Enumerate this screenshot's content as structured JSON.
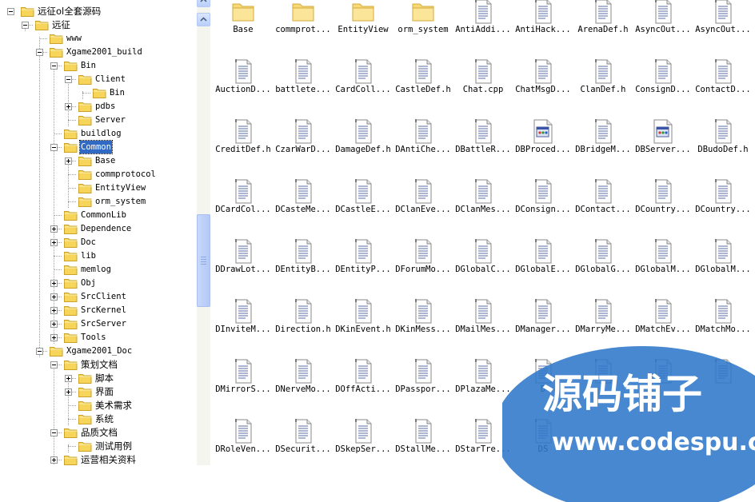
{
  "tree": {
    "items": [
      {
        "label": "远征ol全套源码",
        "depth": 0,
        "expander": "minus",
        "selected": false
      },
      {
        "label": "远征",
        "depth": 1,
        "expander": "minus",
        "selected": false
      },
      {
        "label": "www",
        "depth": 2,
        "expander": "none",
        "selected": false
      },
      {
        "label": "Xgame2001_build",
        "depth": 2,
        "expander": "minus",
        "selected": false
      },
      {
        "label": "Bin",
        "depth": 3,
        "expander": "minus",
        "selected": false
      },
      {
        "label": "Client",
        "depth": 4,
        "expander": "minus",
        "selected": false
      },
      {
        "label": "Bin",
        "depth": 5,
        "expander": "none",
        "selected": false
      },
      {
        "label": "pdbs",
        "depth": 4,
        "expander": "plus",
        "selected": false
      },
      {
        "label": "Server",
        "depth": 4,
        "expander": "none",
        "selected": false
      },
      {
        "label": "buildlog",
        "depth": 3,
        "expander": "none",
        "selected": false
      },
      {
        "label": "Common",
        "depth": 3,
        "expander": "minus",
        "selected": true
      },
      {
        "label": "Base",
        "depth": 4,
        "expander": "plus",
        "selected": false
      },
      {
        "label": "commprotocol",
        "depth": 4,
        "expander": "none",
        "selected": false
      },
      {
        "label": "EntityView",
        "depth": 4,
        "expander": "none",
        "selected": false
      },
      {
        "label": "orm_system",
        "depth": 4,
        "expander": "none",
        "selected": false
      },
      {
        "label": "CommonLib",
        "depth": 3,
        "expander": "none",
        "selected": false
      },
      {
        "label": "Dependence",
        "depth": 3,
        "expander": "plus",
        "selected": false
      },
      {
        "label": "Doc",
        "depth": 3,
        "expander": "plus",
        "selected": false
      },
      {
        "label": "lib",
        "depth": 3,
        "expander": "none",
        "selected": false
      },
      {
        "label": "memlog",
        "depth": 3,
        "expander": "none",
        "selected": false
      },
      {
        "label": "Obj",
        "depth": 3,
        "expander": "plus",
        "selected": false
      },
      {
        "label": "SrcClient",
        "depth": 3,
        "expander": "plus",
        "selected": false
      },
      {
        "label": "SrcKernel",
        "depth": 3,
        "expander": "plus",
        "selected": false
      },
      {
        "label": "SrcServer",
        "depth": 3,
        "expander": "plus",
        "selected": false
      },
      {
        "label": "Tools",
        "depth": 3,
        "expander": "plus",
        "selected": false
      },
      {
        "label": "Xgame2001_Doc",
        "depth": 2,
        "expander": "minus",
        "selected": false
      },
      {
        "label": "策划文档",
        "depth": 3,
        "expander": "minus",
        "selected": false
      },
      {
        "label": "脚本",
        "depth": 4,
        "expander": "plus",
        "selected": false
      },
      {
        "label": "界面",
        "depth": 4,
        "expander": "plus",
        "selected": false
      },
      {
        "label": "美术需求",
        "depth": 4,
        "expander": "none",
        "selected": false
      },
      {
        "label": "系统",
        "depth": 4,
        "expander": "none",
        "selected": false
      },
      {
        "label": "品质文档",
        "depth": 3,
        "expander": "minus",
        "selected": false
      },
      {
        "label": "测试用例",
        "depth": 4,
        "expander": "none",
        "selected": false
      },
      {
        "label": "运营相关资料",
        "depth": 3,
        "expander": "plus",
        "selected": false
      }
    ]
  },
  "files": {
    "items": [
      {
        "name": "Base",
        "type": "folder"
      },
      {
        "name": "commprot...",
        "type": "folder"
      },
      {
        "name": "EntityView",
        "type": "folder"
      },
      {
        "name": "orm_system",
        "type": "folder"
      },
      {
        "name": "AntiAddi...",
        "type": "header"
      },
      {
        "name": "AntiHack...",
        "type": "header"
      },
      {
        "name": "ArenaDef.h",
        "type": "header"
      },
      {
        "name": "AsyncOut...",
        "type": "header"
      },
      {
        "name": "AsyncOut...",
        "type": "header"
      },
      {
        "name": "AuctionD...",
        "type": "header"
      },
      {
        "name": "battlete...",
        "type": "header"
      },
      {
        "name": "CardColl...",
        "type": "header"
      },
      {
        "name": "CastleDef.h",
        "type": "header"
      },
      {
        "name": "Chat.cpp",
        "type": "header"
      },
      {
        "name": "ChatMsgD...",
        "type": "header"
      },
      {
        "name": "ClanDef.h",
        "type": "header"
      },
      {
        "name": "ConsignD...",
        "type": "header"
      },
      {
        "name": "ContactD...",
        "type": "header"
      },
      {
        "name": "CreditDef.h",
        "type": "header"
      },
      {
        "name": "CzarWarD...",
        "type": "header"
      },
      {
        "name": "DamageDef.h",
        "type": "header"
      },
      {
        "name": "DAntiChe...",
        "type": "header"
      },
      {
        "name": "DBattleR...",
        "type": "header"
      },
      {
        "name": "DBProced...",
        "type": "app"
      },
      {
        "name": "DBridgeM...",
        "type": "header"
      },
      {
        "name": "DBServer...",
        "type": "app"
      },
      {
        "name": "DBudoDef.h",
        "type": "header"
      },
      {
        "name": "DCardCol...",
        "type": "header"
      },
      {
        "name": "DCasteMe...",
        "type": "header"
      },
      {
        "name": "DCastleE...",
        "type": "header"
      },
      {
        "name": "DClanEve...",
        "type": "header"
      },
      {
        "name": "DClanMes...",
        "type": "header"
      },
      {
        "name": "DConsign...",
        "type": "header"
      },
      {
        "name": "DContact...",
        "type": "header"
      },
      {
        "name": "DCountry...",
        "type": "header"
      },
      {
        "name": "DCountry...",
        "type": "header"
      },
      {
        "name": "DDrawLot...",
        "type": "header"
      },
      {
        "name": "DEntityB...",
        "type": "header"
      },
      {
        "name": "DEntityP...",
        "type": "header"
      },
      {
        "name": "DForumMo...",
        "type": "header"
      },
      {
        "name": "DGlobalC...",
        "type": "header"
      },
      {
        "name": "DGlobalE...",
        "type": "header"
      },
      {
        "name": "DGlobalG...",
        "type": "header"
      },
      {
        "name": "DGlobalM...",
        "type": "header"
      },
      {
        "name": "DGlobalM...",
        "type": "header"
      },
      {
        "name": "DInviteM...",
        "type": "header"
      },
      {
        "name": "Direction.h",
        "type": "header"
      },
      {
        "name": "DKinEvent.h",
        "type": "header"
      },
      {
        "name": "DKinMess...",
        "type": "header"
      },
      {
        "name": "DMailMes...",
        "type": "header"
      },
      {
        "name": "DManager...",
        "type": "header"
      },
      {
        "name": "DMarryMe...",
        "type": "header"
      },
      {
        "name": "DMatchEv...",
        "type": "header"
      },
      {
        "name": "DMatchMo...",
        "type": "header"
      },
      {
        "name": "DMirrorS...",
        "type": "header"
      },
      {
        "name": "DNerveMo...",
        "type": "header"
      },
      {
        "name": "DOffActi...",
        "type": "header"
      },
      {
        "name": "DPasspor...",
        "type": "header"
      },
      {
        "name": "DPlazaMe...",
        "type": "header"
      },
      {
        "name": "D",
        "type": "header"
      },
      {
        "name": "",
        "type": "header"
      },
      {
        "name": "",
        "type": "header"
      },
      {
        "name": "",
        "type": "header"
      },
      {
        "name": "DRoleVen...",
        "type": "header"
      },
      {
        "name": "DSecurit...",
        "type": "header"
      },
      {
        "name": "DSkepSer...",
        "type": "header"
      },
      {
        "name": "DStallMe...",
        "type": "header"
      },
      {
        "name": "DStarTre...",
        "type": "header"
      },
      {
        "name": "DS",
        "type": "header"
      }
    ]
  },
  "watermark": {
    "title": "源码铺子",
    "url": "www.codespu.com"
  },
  "colors": {
    "selection": "#316ac5",
    "folder": "#f6d55a",
    "scrollbar": "#c1d3fb",
    "watermark": "#2f77c9"
  }
}
